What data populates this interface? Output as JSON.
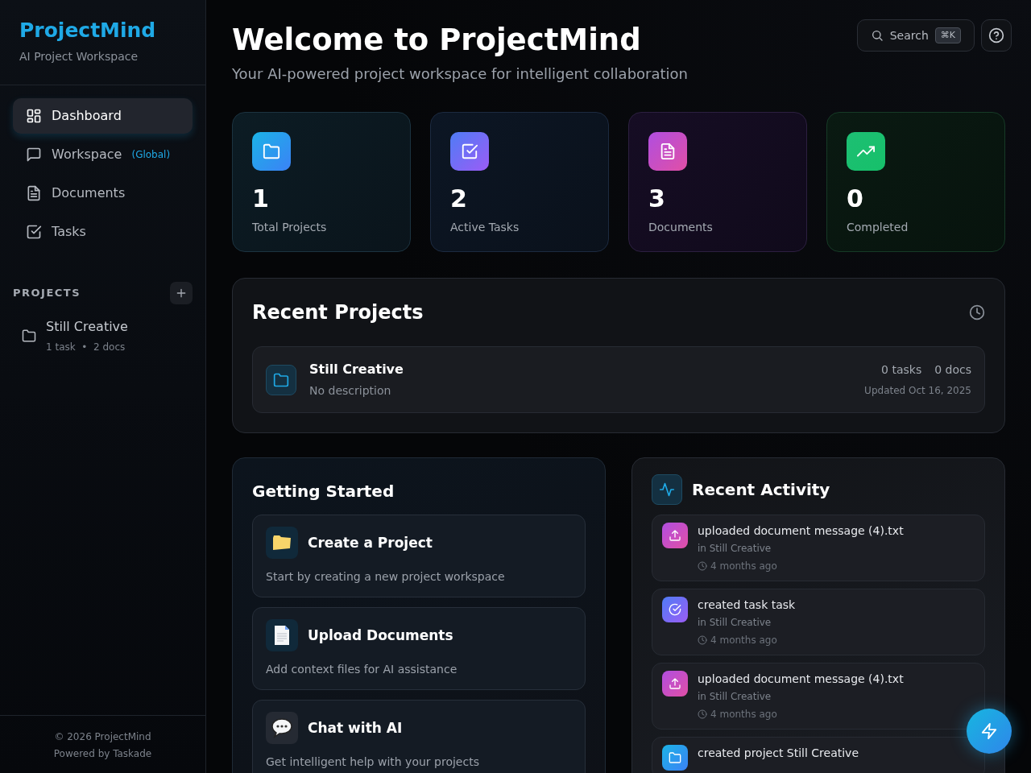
{
  "sidebar": {
    "brand": "ProjectMind",
    "tagline": "AI Project Workspace",
    "nav": [
      {
        "label": "Dashboard",
        "kind": "dashboard",
        "selected": true
      },
      {
        "label": "Workspace",
        "kind": "workspace",
        "tag": "(Global)",
        "selected": false
      },
      {
        "label": "Documents",
        "kind": "documents",
        "selected": false
      },
      {
        "label": "Tasks",
        "kind": "tasks",
        "selected": false
      }
    ],
    "projects_heading": "PROJECTS",
    "projects": [
      {
        "name": "Still Creative",
        "tasks": "1 task",
        "separator": "•",
        "docs": "2 docs"
      }
    ],
    "footer": [
      "© 2026 ProjectMind",
      "Powered by Taskade"
    ]
  },
  "header": {
    "title": "Welcome to ProjectMind",
    "subtitle": "Your AI-powered project workspace for intelligent collaboration",
    "search": {
      "label": "Search",
      "shortcut": "⌘K"
    }
  },
  "stats": [
    {
      "kind": "projects",
      "value": "1",
      "label": "Total Projects"
    },
    {
      "kind": "tasks",
      "value": "2",
      "label": "Active Tasks"
    },
    {
      "kind": "documents",
      "value": "3",
      "label": "Documents"
    },
    {
      "kind": "completed",
      "value": "0",
      "label": "Completed"
    }
  ],
  "recent_projects": {
    "title": "Recent Projects",
    "items": [
      {
        "name": "Still Creative",
        "description": "No description",
        "tasks": "0 tasks",
        "docs": "0 docs",
        "updated": "Updated Oct 16, 2025"
      }
    ]
  },
  "getting_started": {
    "title": "Getting Started",
    "items": [
      {
        "kind": "folder",
        "title": "Create a Project",
        "text": "Start by creating a new project workspace"
      },
      {
        "kind": "document",
        "title": "Upload Documents",
        "text": "Add context files for AI assistance"
      },
      {
        "kind": "chat",
        "title": "Chat with AI",
        "text": "Get intelligent help with your projects"
      }
    ]
  },
  "recent_activity": {
    "title": "Recent Activity",
    "items": [
      {
        "kind": "upload",
        "text": "uploaded document message (4).txt",
        "project": "in Still Creative",
        "time": "4 months ago"
      },
      {
        "kind": "task",
        "text": "created task task",
        "project": "in Still Creative",
        "time": "4 months ago"
      },
      {
        "kind": "upload",
        "text": "uploaded document message (4).txt",
        "project": "in Still Creative",
        "time": "4 months ago"
      },
      {
        "kind": "project",
        "text": "created project Still Creative"
      }
    ]
  }
}
